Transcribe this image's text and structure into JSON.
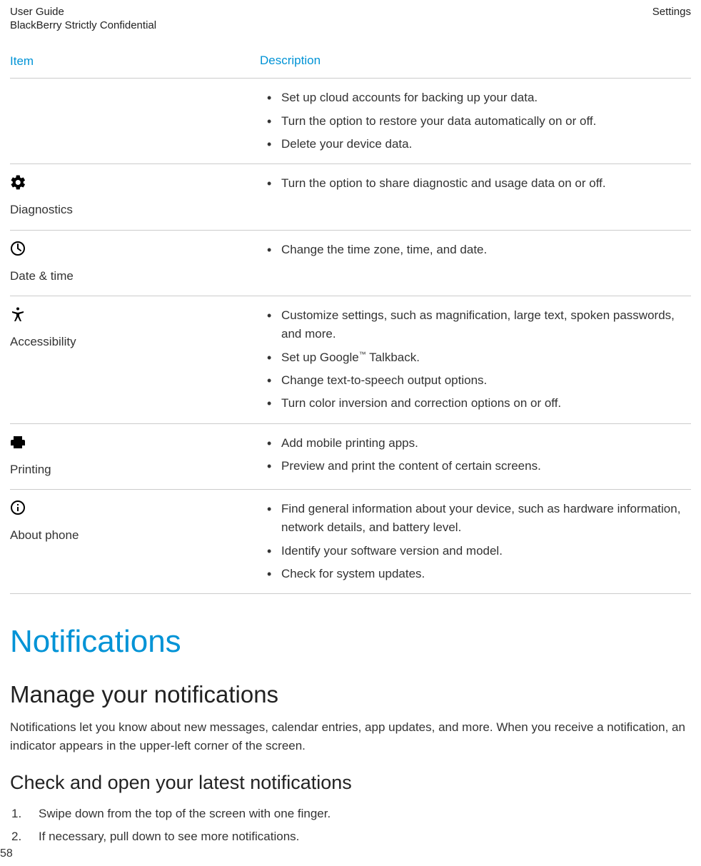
{
  "header": {
    "left_line1": "User Guide",
    "left_line2": "BlackBerry Strictly Confidential",
    "right": "Settings"
  },
  "table": {
    "head_item": "Item",
    "head_desc": "Description",
    "rows": [
      {
        "icon": "",
        "label": "",
        "bullets": [
          "Set up cloud accounts for backing up your data.",
          "Turn the option to restore your data automatically on or off.",
          "Delete your device data."
        ]
      },
      {
        "icon": "gear",
        "label": "Diagnostics",
        "bullets": [
          "Turn the option to share diagnostic and usage data on or off."
        ]
      },
      {
        "icon": "clock",
        "label": "Date & time",
        "bullets": [
          "Change the time zone, time, and date."
        ]
      },
      {
        "icon": "accessibility",
        "label": "Accessibility",
        "bullets": [
          "Customize settings, such as magnification, large text, spoken passwords, and more.",
          "Set up Google™ Talkback.",
          "Change text-to-speech output options.",
          "Turn color inversion and correction options on or off."
        ]
      },
      {
        "icon": "printer",
        "label": "Printing",
        "bullets": [
          "Add mobile printing apps.",
          "Preview and print the content of certain screens."
        ]
      },
      {
        "icon": "info",
        "label": "About phone",
        "bullets": [
          "Find general information about your device, such as hardware information, network details, and battery level.",
          "Identify your software version and model.",
          "Check for system updates."
        ]
      }
    ]
  },
  "sections": {
    "h1": "Notifications",
    "h2": "Manage your notifications",
    "p1": "Notifications let you know about new messages, calendar entries, app updates, and more. When you receive a notification, an indicator appears in the upper-left corner of the screen.",
    "h3": "Check and open your latest notifications",
    "steps": [
      "Swipe down from the top of the screen with one finger.",
      "If necessary, pull down to see more notifications."
    ]
  },
  "page_number": "58"
}
